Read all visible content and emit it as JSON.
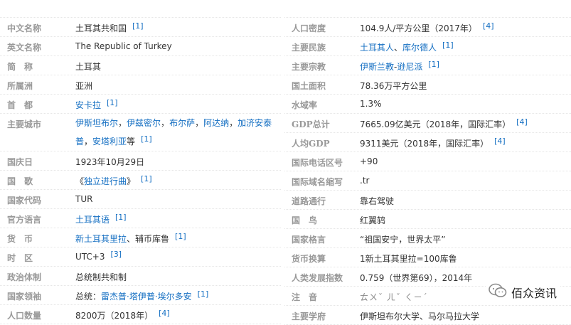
{
  "left": [
    {
      "label": "中文名称",
      "segments": [
        {
          "text": "土耳其共和国"
        }
      ],
      "sup": "[1]"
    },
    {
      "label": "英文名称",
      "segments": [
        {
          "text": "The Republic of Turkey"
        }
      ],
      "sup": ""
    },
    {
      "label": "简　称",
      "segments": [
        {
          "text": "土耳其"
        }
      ],
      "sup": ""
    },
    {
      "label": "所属洲",
      "segments": [
        {
          "text": "亚洲"
        }
      ],
      "sup": ""
    },
    {
      "label": "首　都",
      "segments": [
        {
          "text": "安卡拉",
          "link": true
        }
      ],
      "sup": "[1]"
    },
    {
      "label": "主要城市",
      "segments": [
        {
          "text": "伊斯坦布尔",
          "link": true
        },
        {
          "text": "，"
        },
        {
          "text": "伊兹密尔",
          "link": true
        },
        {
          "text": "，"
        },
        {
          "text": "布尔萨",
          "link": true
        },
        {
          "text": "，"
        },
        {
          "text": "阿达纳",
          "link": true
        },
        {
          "text": "，"
        },
        {
          "text": "加济安泰普",
          "link": true
        },
        {
          "text": "，"
        },
        {
          "text": "安塔利亚",
          "link": true
        },
        {
          "text": "等"
        }
      ],
      "sup": "[1]",
      "tall": true
    },
    {
      "label": "国庆日",
      "segments": [
        {
          "text": "1923年10月29日"
        }
      ],
      "sup": ""
    },
    {
      "label": "国　歌",
      "segments": [
        {
          "text": "《"
        },
        {
          "text": "独立进行曲",
          "link": true
        },
        {
          "text": "》"
        }
      ],
      "sup": "[1]"
    },
    {
      "label": "国家代码",
      "segments": [
        {
          "text": "TUR"
        }
      ],
      "sup": ""
    },
    {
      "label": "官方语言",
      "segments": [
        {
          "text": "土耳其语",
          "link": true
        }
      ],
      "sup": "[1]"
    },
    {
      "label": "货　币",
      "segments": [
        {
          "text": "新土耳其里拉",
          "link": true
        },
        {
          "text": "、辅币库鲁"
        }
      ],
      "sup": "[1]"
    },
    {
      "label": "时　区",
      "segments": [
        {
          "text": "UTC+3"
        }
      ],
      "sup": "[3]"
    },
    {
      "label": "政治体制",
      "segments": [
        {
          "text": "总统制共和制"
        }
      ],
      "sup": ""
    },
    {
      "label": "国家领袖",
      "segments": [
        {
          "text": "总统："
        },
        {
          "text": "雷杰普·塔伊普·埃尔多安",
          "link": true
        }
      ],
      "sup": "[1]"
    },
    {
      "label": "人口数量",
      "segments": [
        {
          "text": "8200万（2018年）"
        }
      ],
      "sup": "[4]"
    }
  ],
  "right": [
    {
      "label": "人口密度",
      "segments": [
        {
          "text": "104.9人/平方公里（2017年）"
        }
      ],
      "sup": "[4]"
    },
    {
      "label": "主要民族",
      "segments": [
        {
          "text": "土耳其人",
          "link": true
        },
        {
          "text": "、"
        },
        {
          "text": "库尔德人",
          "link": true
        }
      ],
      "sup": "[1]"
    },
    {
      "label": "主要宗教",
      "segments": [
        {
          "text": "伊斯兰教",
          "link": true
        },
        {
          "text": "-"
        },
        {
          "text": "逊尼派",
          "link": true
        }
      ],
      "sup": "[1]"
    },
    {
      "label": "国土面积",
      "segments": [
        {
          "text": "78.36万平方公里"
        }
      ],
      "sup": ""
    },
    {
      "label": "水域率",
      "segments": [
        {
          "text": "1.3%"
        }
      ],
      "sup": ""
    },
    {
      "label": "GDP总计",
      "segments": [
        {
          "text": "7665.09亿美元（2018年，国际汇率）"
        }
      ],
      "sup": "[4]"
    },
    {
      "label": "人均GDP",
      "segments": [
        {
          "text": "9311美元（2018年，国际汇率）"
        }
      ],
      "sup": "[4]"
    },
    {
      "label": "国际电话区号",
      "segments": [
        {
          "text": "+90"
        }
      ],
      "sup": ""
    },
    {
      "label": "国际域名缩写",
      "segments": [
        {
          "text": ".tr"
        }
      ],
      "sup": ""
    },
    {
      "label": "道路通行",
      "segments": [
        {
          "text": "靠右驾驶"
        }
      ],
      "sup": ""
    },
    {
      "label": "国　鸟",
      "segments": [
        {
          "text": "红翼鸫"
        }
      ],
      "sup": ""
    },
    {
      "label": "国家格言",
      "segments": [
        {
          "text": "“祖国安宁，世界太平”"
        }
      ],
      "sup": ""
    },
    {
      "label": "货币换算",
      "segments": [
        {
          "text": "1新土耳其里拉=100库鲁"
        }
      ],
      "sup": ""
    },
    {
      "label": "人类发展指数",
      "segments": [
        {
          "text": "0.759（世界第69），2014年"
        }
      ],
      "sup": ""
    },
    {
      "label": "注　音",
      "segments": [
        {
          "text": "ㄊㄨˇ ㄦˇ ㄑㄧˊ",
          "blur": true
        }
      ],
      "sup": ""
    },
    {
      "label": "主要学府",
      "segments": [
        {
          "text": "伊斯坦布尔大学、马尔马拉大学"
        }
      ],
      "sup": ""
    }
  ],
  "watermark": {
    "text": "佰众资讯",
    "icon": "wechat-icon"
  },
  "colors": {
    "label": "#999999",
    "link": "#136ec2",
    "text": "#333333"
  }
}
